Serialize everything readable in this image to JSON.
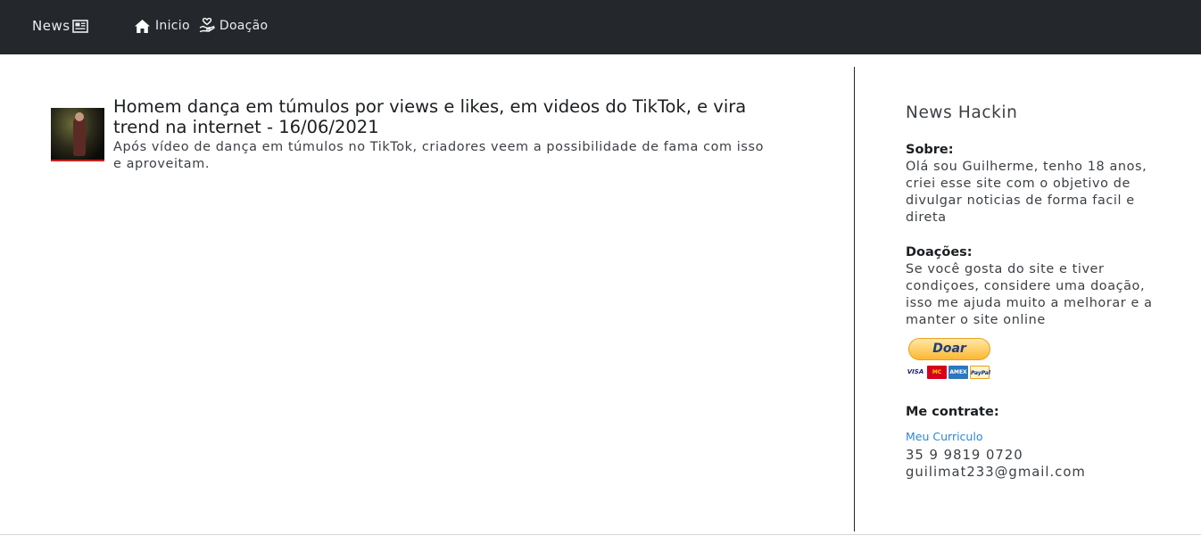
{
  "navbar": {
    "brand_label": "News",
    "links": [
      {
        "label": "Inicio",
        "icon": "home-icon"
      },
      {
        "label": "Doação",
        "icon": "hand-holding-heart-icon"
      }
    ],
    "background": "#24282c"
  },
  "article": {
    "title": "Homem dança em túmulos por views e likes, em videos do TikTok, e vira trend na internet - 16/06/2021",
    "description": "Após vídeo de dança em túmulos no TikTok, criadores veem a possibilidade de fama com isso e aproveitam."
  },
  "sidebar": {
    "title": "News Hackin",
    "sobre_heading": "Sobre:",
    "sobre_text": "Olá sou Guilherme, tenho 18 anos, criei esse site com o objetivo de divulgar noticias de forma facil e direta",
    "doacoes_heading": "Doações:",
    "doacoes_text": "Se você gosta do site e tiver condiçoes, considere uma doação, isso me ajuda muito a melhorar e a manter o site online",
    "donate_button_label": "Doar",
    "contrate_heading": "Me contrate:",
    "curriculo_link": "Meu Curriculo",
    "phone": "35 9 9819 0720",
    "email": "guilimat233@gmail.com"
  },
  "colors": {
    "link": "#2f86d6",
    "navbar_text": "#e9ecef"
  }
}
